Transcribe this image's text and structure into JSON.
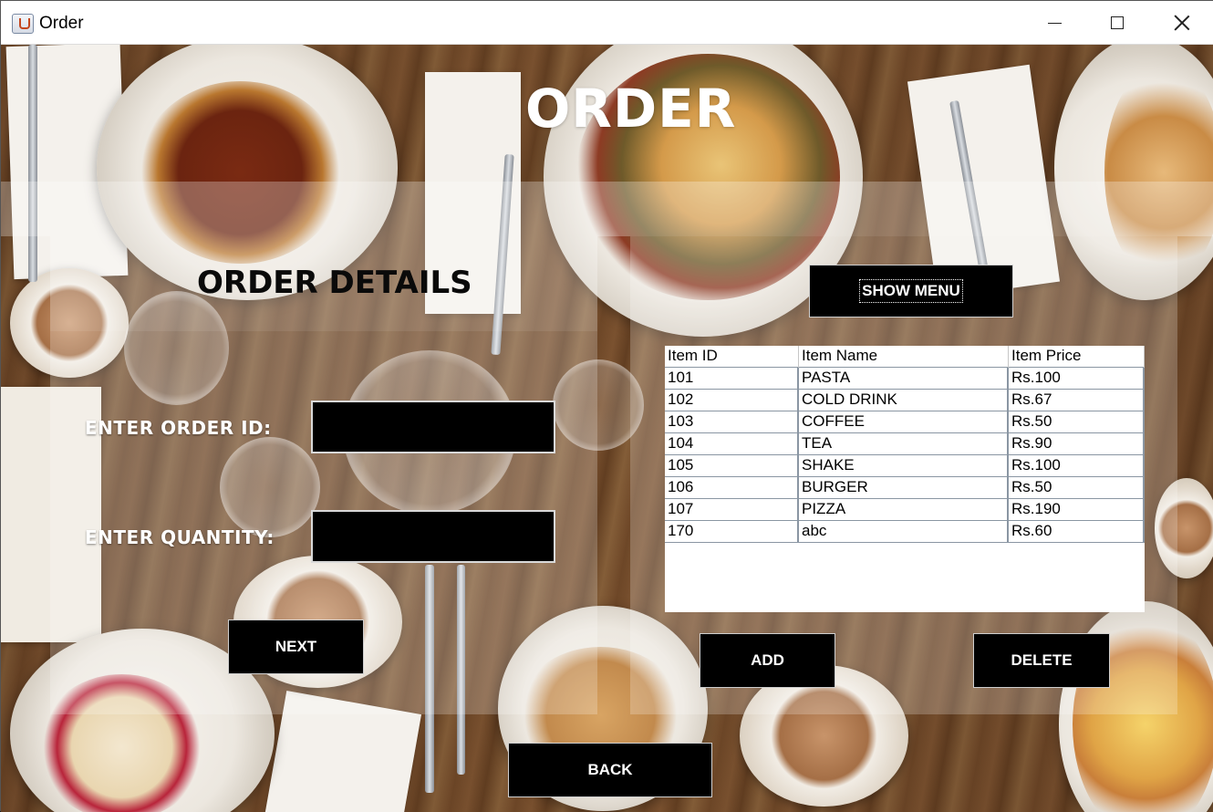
{
  "window": {
    "title": "Order"
  },
  "page": {
    "heading": "ORDER",
    "section_title": "ORDER DETAILS"
  },
  "form": {
    "order_id_label": "ENTER ORDER ID:",
    "order_id_value": "",
    "quantity_label": "ENTER QUANTITY:",
    "quantity_value": "",
    "next_label": "NEXT"
  },
  "menu": {
    "show_menu_label": "SHOW MENU",
    "add_label": "ADD",
    "delete_label": "DELETE",
    "columns": [
      "Item ID",
      "Item Name",
      "Item Price"
    ],
    "rows": [
      [
        "101",
        "PASTA",
        "Rs.100"
      ],
      [
        "102",
        "COLD DRINK",
        "Rs.67"
      ],
      [
        "103",
        "COFFEE",
        "Rs.50"
      ],
      [
        "104",
        "TEA",
        "Rs.90"
      ],
      [
        "105",
        "SHAKE",
        "Rs.100"
      ],
      [
        "106",
        "BURGER",
        "Rs.50"
      ],
      [
        "107",
        "PIZZA",
        "Rs.190"
      ],
      [
        "170",
        "abc",
        "Rs.60"
      ]
    ]
  },
  "footer": {
    "back_label": "BACK"
  },
  "icons": [
    "java-app-icon",
    "minimize-icon",
    "maximize-icon",
    "close-icon"
  ],
  "colors": {
    "button_bg": "#000000",
    "heading_white": "#ffffff",
    "heading_dark": "#0a0a0a",
    "panel_veil": "rgba(255,255,255,0.28)"
  }
}
